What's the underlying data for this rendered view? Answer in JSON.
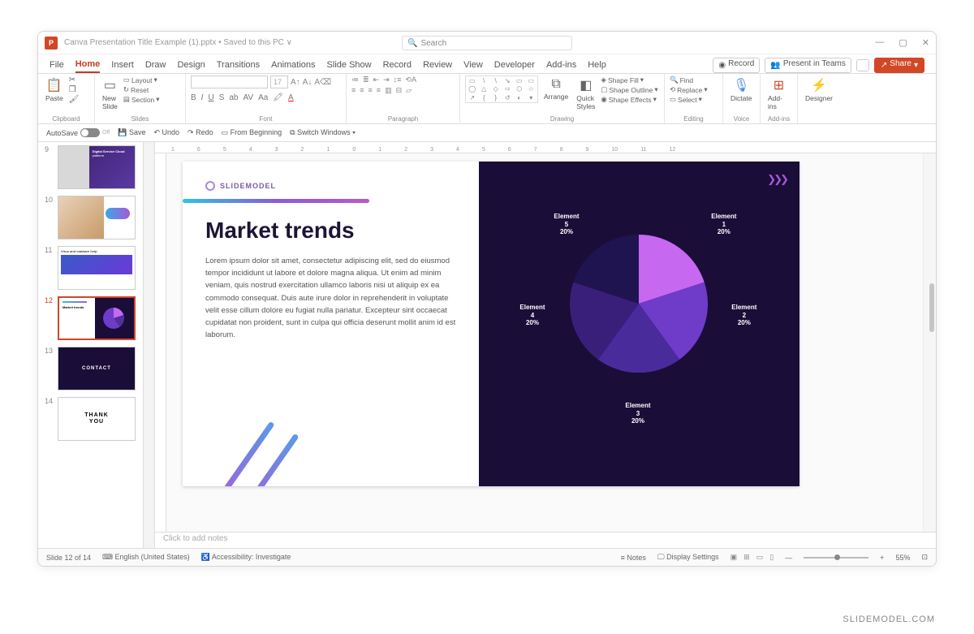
{
  "title": "Canva Presentation Title Example (1).pptx • Saved to this PC ∨",
  "search_placeholder": "Search",
  "menu": {
    "file": "File",
    "home": "Home",
    "insert": "Insert",
    "draw": "Draw",
    "design": "Design",
    "transitions": "Transitions",
    "animations": "Animations",
    "slideshow": "Slide Show",
    "record": "Record",
    "review": "Review",
    "view": "View",
    "developer": "Developer",
    "addins": "Add-ins",
    "help": "Help"
  },
  "actions": {
    "record": "Record",
    "present": "Present in Teams",
    "share": "Share"
  },
  "ribbon": {
    "clipboard": {
      "label": "Clipboard",
      "paste": "Paste"
    },
    "slides": {
      "label": "Slides",
      "new": "New\nSlide",
      "layout": "Layout",
      "reset": "Reset",
      "section": "Section"
    },
    "font": {
      "label": "Font",
      "size": "17"
    },
    "paragraph": {
      "label": "Paragraph"
    },
    "drawing": {
      "label": "Drawing",
      "arrange": "Arrange",
      "quick": "Quick\nStyles",
      "fill": "Shape Fill",
      "outline": "Shape Outline",
      "effects": "Shape Effects"
    },
    "editing": {
      "label": "Editing",
      "find": "Find",
      "replace": "Replace",
      "select": "Select"
    },
    "voice": {
      "label": "Voice",
      "dictate": "Dictate"
    },
    "addins": {
      "label": "Add-ins",
      "btn": "Add-ins"
    },
    "designer": {
      "label": "",
      "btn": "Designer"
    }
  },
  "qat": {
    "autosave": "AutoSave",
    "off": "Off",
    "save": "Save",
    "undo": "Undo",
    "redo": "Redo",
    "begin": "From Beginning",
    "switch": "Switch Windows"
  },
  "thumbs": {
    "n9": "9",
    "n10": "10",
    "n11": "11",
    "n12": "12",
    "n13": "13",
    "n14": "14",
    "t9a": "Digital Service Cloud",
    "t9b": "platform",
    "t11": "Virus and malware help",
    "t12": "Market trends",
    "t13": "CONTACT",
    "t14a": "THANK",
    "t14b": "YOU"
  },
  "ruler": [
    "1",
    "6",
    "5",
    "4",
    "3",
    "2",
    "1",
    "0",
    "1",
    "2",
    "3",
    "4",
    "5",
    "6",
    "7",
    "8",
    "9",
    "10",
    "11",
    "12"
  ],
  "slide": {
    "brand": "SLIDEMODEL",
    "title": "Market trends",
    "body": "Lorem ipsum dolor sit amet, consectetur adipiscing elit, sed do eiusmod tempor incididunt ut labore et dolore magna aliqua. Ut enim ad minim veniam, quis nostrud exercitation ullamco laboris nisi ut aliquip ex ea commodo consequat. Duis aute irure dolor in reprehenderit in voluptate velit esse cillum dolore eu fugiat nulla pariatur. Excepteur sint occaecat cupidatat non proident, sunt in culpa qui officia deserunt mollit anim id est laborum."
  },
  "chart_data": {
    "type": "pie",
    "categories": [
      "Element 1",
      "Element 2",
      "Element 3",
      "Element 4",
      "Element 5"
    ],
    "values": [
      20,
      20,
      20,
      20,
      20
    ],
    "colors": [
      "#c768f0",
      "#6e3cc9",
      "#4a2b9c",
      "#3a1f7a",
      "#1f1450"
    ],
    "labels": {
      "e1": {
        "name": "Element",
        "num": "1",
        "pct": "20%"
      },
      "e2": {
        "name": "Element",
        "num": "2",
        "pct": "20%"
      },
      "e3": {
        "name": "Element",
        "num": "3",
        "pct": "20%"
      },
      "e4": {
        "name": "Element",
        "num": "4",
        "pct": "20%"
      },
      "e5": {
        "name": "Element",
        "num": "5",
        "pct": "20%"
      }
    }
  },
  "notes_placeholder": "Click to add notes",
  "status": {
    "slide": "Slide 12 of 14",
    "lang": "English (United States)",
    "access": "Accessibility: Investigate",
    "notes": "Notes",
    "display": "Display Settings",
    "zoom": "55%"
  },
  "watermark": "SLIDEMODEL.COM"
}
